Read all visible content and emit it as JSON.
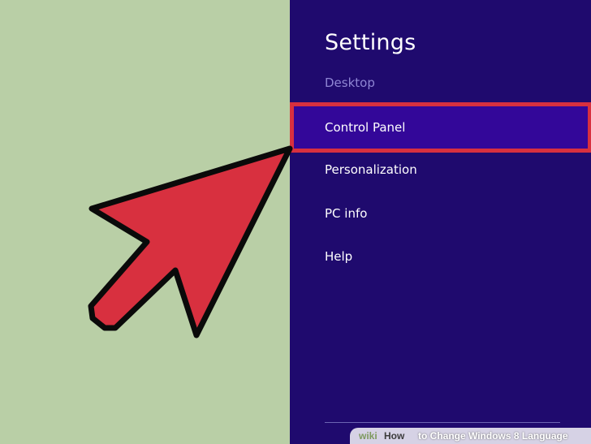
{
  "settings_panel": {
    "title": "Settings",
    "subtitle": "Desktop",
    "items": [
      {
        "label": "Control Panel",
        "highlighted": true
      },
      {
        "label": "Personalization",
        "highlighted": false
      },
      {
        "label": "PC info",
        "highlighted": false
      },
      {
        "label": "Help",
        "highlighted": false
      }
    ]
  },
  "watermark": {
    "brand": "wiki",
    "how": "How",
    "title": "to Change Windows 8 Language"
  },
  "colors": {
    "panel_background": "#1f0a6e",
    "highlight_fill": "#330799",
    "highlight_border": "#d8303f",
    "desktop_background": "#b9cfa6",
    "arrow_fill": "#d8303f"
  },
  "icons": {
    "pointer": "red-arrow-icon"
  }
}
